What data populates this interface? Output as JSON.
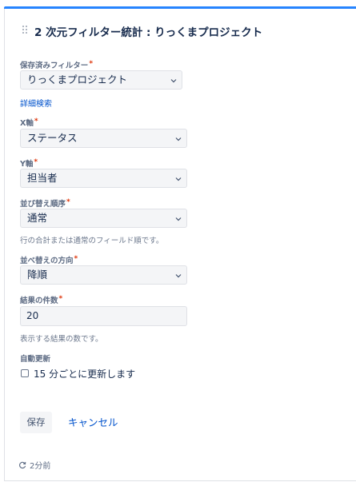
{
  "gadget": {
    "title": "2 次元フィルター統計 : りっくまプロジェクト"
  },
  "form": {
    "saved_filter": {
      "label": "保存済みフィルター",
      "required": "*",
      "value": "りっくまプロジェクト"
    },
    "advanced_search_link": "詳細検索",
    "x_axis": {
      "label": "X軸",
      "required": "*",
      "value": "ステータス"
    },
    "y_axis": {
      "label": "Y軸",
      "required": "*",
      "value": "担当者"
    },
    "sort_order": {
      "label": "並び替え順序",
      "required": "*",
      "value": "通常",
      "help": "行の合計または通常のフィールド順です。"
    },
    "sort_direction": {
      "label": "並べ替えの方向",
      "required": "*",
      "value": "降順"
    },
    "result_count": {
      "label": "結果の件数",
      "required": "*",
      "value": "20",
      "help": "表示する結果の数です。"
    },
    "auto_refresh": {
      "label": "自動更新",
      "checkbox_label": "15 分ごとに更新します",
      "checked": false
    }
  },
  "actions": {
    "save": "保存",
    "cancel": "キャンセル"
  },
  "footer": {
    "refresh_time": "2分前"
  },
  "colors": {
    "accent": "#2684ff",
    "link": "#0052cc",
    "required": "#de350b"
  }
}
